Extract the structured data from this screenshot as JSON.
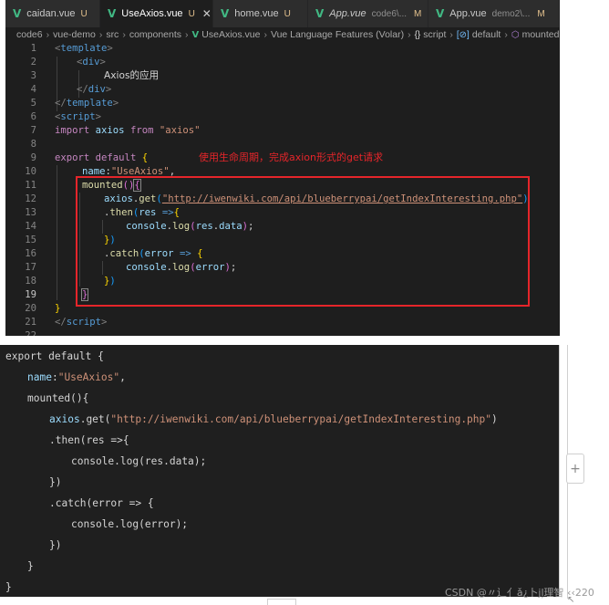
{
  "tabs": [
    {
      "name": "caidan.vue",
      "status": "U"
    },
    {
      "name": "UseAxios.vue",
      "status": "U",
      "close": "✕"
    },
    {
      "name": "home.vue",
      "status": "U"
    },
    {
      "name": "App.vue",
      "desc": "code6\\...",
      "status": "M"
    },
    {
      "name": "App.vue",
      "desc": "demo2\\...",
      "status": "M"
    }
  ],
  "breadcrumb": {
    "items": [
      "code6",
      "vue-demo",
      "src",
      "components",
      "UseAxios.vue",
      "Vue Language Features (Volar)",
      "script",
      "default",
      "mounted"
    ],
    "script_icon": "{}",
    "default_icon": "[⊘]",
    "mounted_icon": "⬡"
  },
  "line_numbers": [
    "1",
    "2",
    "3",
    "4",
    "5",
    "6",
    "7",
    "8",
    "9",
    "10",
    "11",
    "12",
    "13",
    "14",
    "15",
    "16",
    "17",
    "18",
    "19",
    "20",
    "21",
    "22"
  ],
  "code": {
    "template_tag": "template",
    "div_tag": "div",
    "div_text": "Axios的应用",
    "script_tag": "script",
    "import_kw": "import",
    "import_name": "axios",
    "from_kw": "from",
    "import_src": "\"axios\"",
    "export_kw": "export",
    "default_kw": "default",
    "name_key": "name",
    "name_value": "\"UseAxios\"",
    "mounted_fn": "mounted",
    "axios_obj": "axios",
    "get_fn": "get",
    "url": "\"http://iwenwiki.com/api/blueberrypai/getIndexInteresting.php\"",
    "then_fn": "then",
    "res_param": "res",
    "console_obj": "console",
    "log_fn": "log",
    "res_data": "data",
    "catch_fn": "catch",
    "error_param": "error"
  },
  "annotation": "使用生命周期，完成axion形式的get请求",
  "plus_label": "+",
  "watermark": "CSDN @〃辶亻ǎ¿卜jļ理智 ‹‹220",
  "corner_icon": "↖"
}
